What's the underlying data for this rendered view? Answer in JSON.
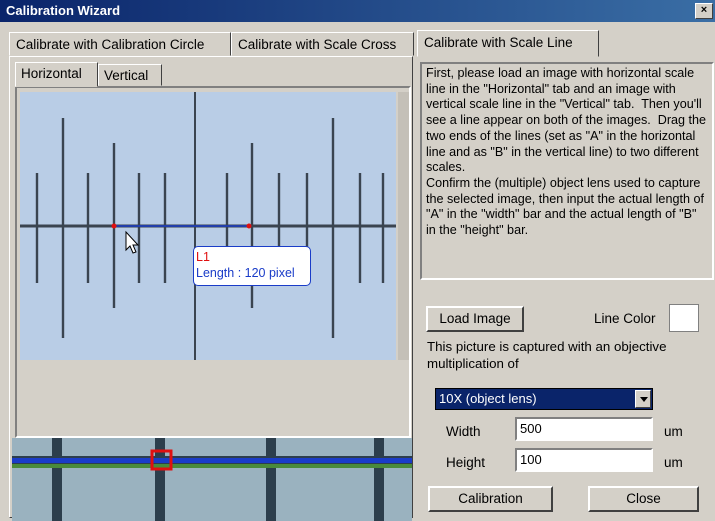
{
  "window": {
    "title": "Calibration Wizard",
    "close_glyph": "×"
  },
  "tabs": [
    "Calibrate with Calibration Circle",
    "Calibrate with Scale Cross",
    "Calibrate with Scale Line"
  ],
  "subtabs": [
    "Horizontal",
    "Vertical"
  ],
  "image_label": {
    "name": "L1",
    "length": "Length : 120 pixel"
  },
  "instructions": "First, please load an image with horizontal scale line in the \"Horizontal\" tab and an image with vertical scale line in the \"Vertical\" tab.  Then you'll see a line appear on both of the images.  Drag the two ends of the lines (set as \"A\" in the horizontal line and as \"B\" in the vertical line) to two different scales.\nConfirm the (multiple) object lens used to capture the selected image, then input the actual length of \"A\" in the \"width\" bar and the actual length of \"B\" in the \"height\" bar.",
  "load_image_label": "Load Image",
  "line_color_label": "Line Color",
  "line_color_value": "#ffffff",
  "objective_text": "This picture is captured with an objective multiplication of",
  "objective_selected": "10X (object lens)",
  "width_label": "Width",
  "width_value": "500",
  "width_unit": "um",
  "height_label": "Height",
  "height_value": "100",
  "height_unit": "um",
  "calibration_label": "Calibration",
  "close_label": "Close",
  "colors": {
    "title_bar": "#0a246a",
    "measure_line": "#1a3cc8",
    "marker": "#e01010",
    "image_bg": "#b9cde6"
  }
}
